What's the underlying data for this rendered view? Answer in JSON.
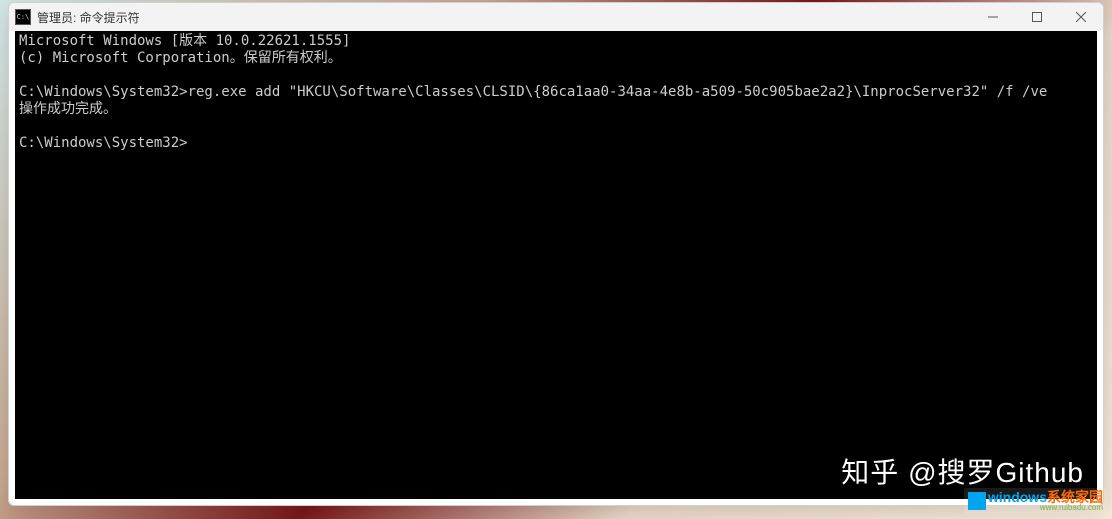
{
  "window": {
    "title": "管理员: 命令提示符",
    "icon_text": "C:\\"
  },
  "terminal": {
    "lines": [
      "Microsoft Windows [版本 10.0.22621.1555]",
      "(c) Microsoft Corporation。保留所有权利。",
      "",
      "C:\\Windows\\System32>reg.exe add \"HKCU\\Software\\Classes\\CLSID\\{86ca1aa0-34aa-4e8b-a509-50c905bae2a2}\\InprocServer32\" /f /ve",
      "操作成功完成。",
      "",
      "C:\\Windows\\System32>"
    ]
  },
  "watermark": {
    "text": "知乎 @搜罗Github"
  },
  "bottom_logo": {
    "main_blue": "windows",
    "main_orange": "系统家园",
    "sub": "www.ruibadu.com"
  }
}
